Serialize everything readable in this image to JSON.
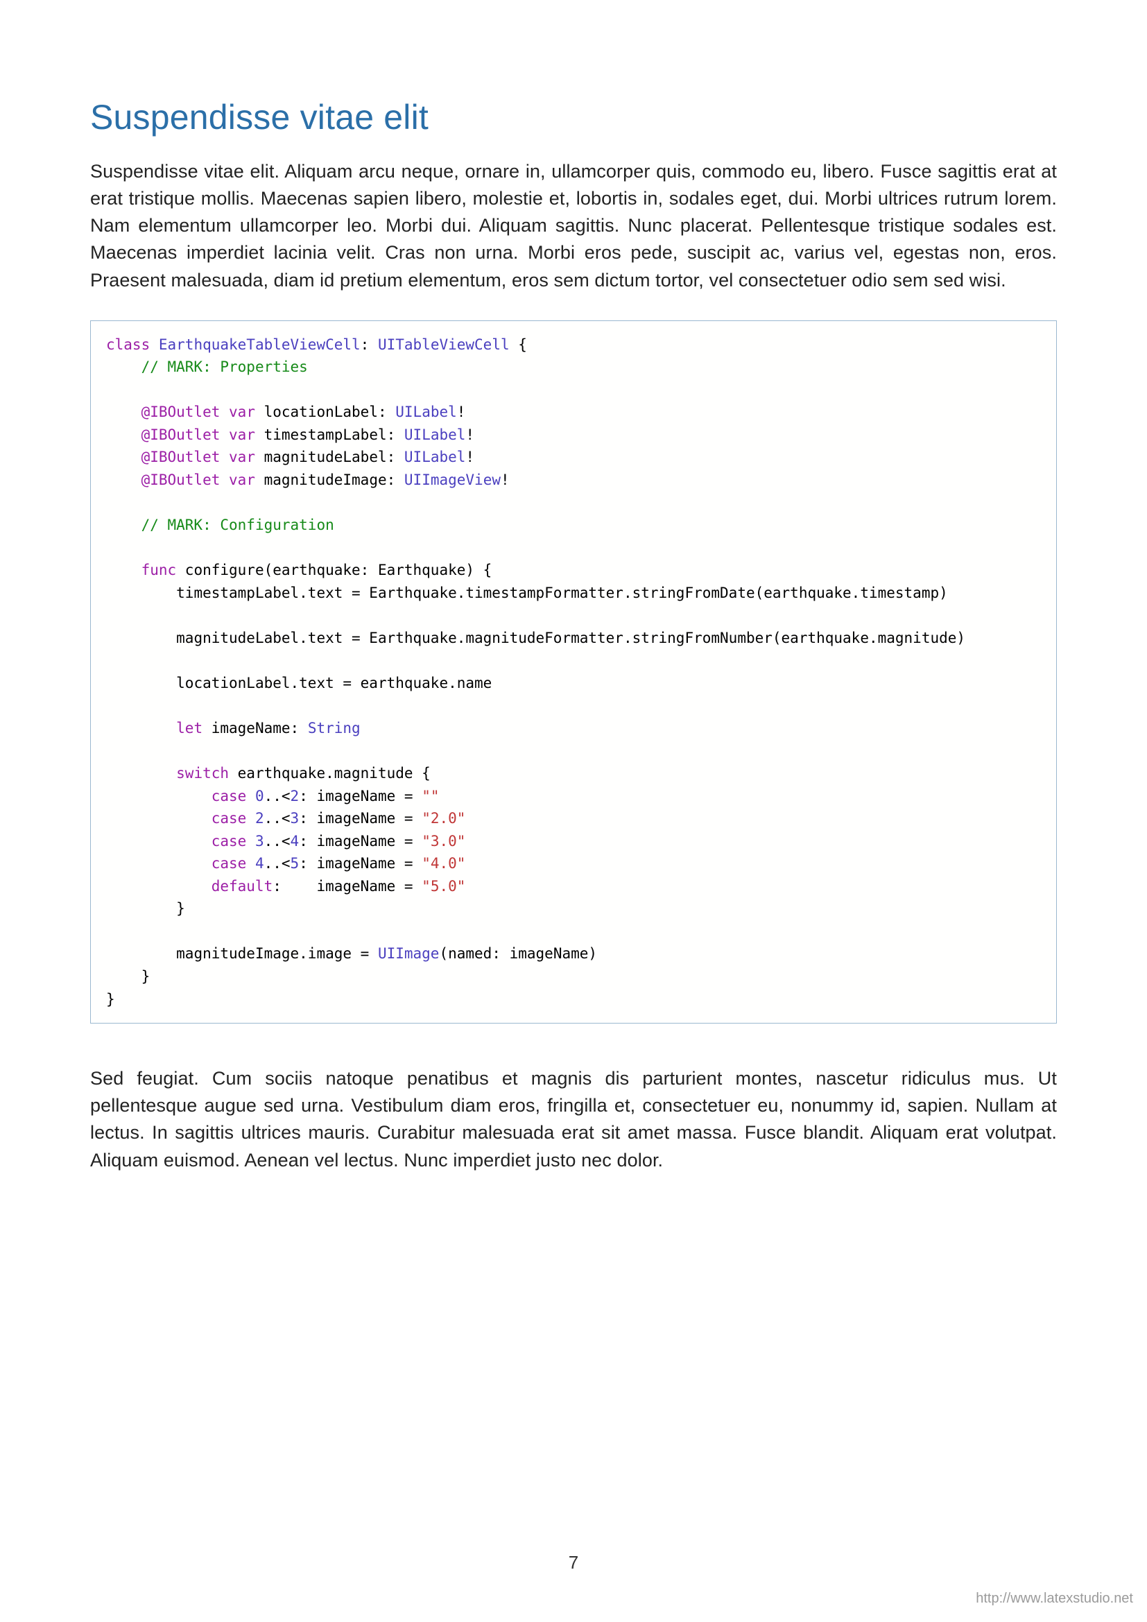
{
  "heading": "Suspendisse vitae elit",
  "paragraph1": "Suspendisse vitae elit. Aliquam arcu neque, ornare in, ullamcorper quis, commodo eu, libero. Fusce sagittis erat at erat tristique mollis. Maecenas sapien libero, molestie et, lobortis in, sodales eget, dui. Morbi ultrices rutrum lorem. Nam elementum ullamcorper leo. Morbi dui. Aliquam sagittis. Nunc placerat. Pellentesque tristique sodales est. Maecenas imperdiet lacinia velit. Cras non urna. Morbi eros pede, suscipit ac, varius vel, egestas non, eros. Praesent malesuada, diam id pretium elementum, eros sem dictum tortor, vel consectetuer odio sem sed wisi.",
  "paragraph2": "Sed feugiat. Cum sociis natoque penatibus et magnis dis parturient montes, nascetur ridiculus mus. Ut pellentesque augue sed urna. Vestibulum diam eros, fringilla et, consectetuer eu, nonummy id, sapien. Nullam at lectus. In sagittis ultrices mauris. Curabitur malesuada erat sit amet massa. Fusce blandit. Aliquam erat volutpat. Aliquam euismod. Aenean vel lectus. Nunc imperdiet justo nec dolor.",
  "code": {
    "l1_kw": "class",
    "l1_type": "EarthquakeTableViewCell",
    "l1_rest1": ": ",
    "l1_type2": "UITableViewCell",
    "l1_rest2": " {",
    "l2_cmt": "// MARK: Properties",
    "l3_attr": "@IBOutlet",
    "l3_kw": "var",
    "l3_txt": " locationLabel: ",
    "l3_type": "UILabel",
    "l3_end": "!",
    "l4_txt": " timestampLabel: ",
    "l5_txt": " magnitudeLabel: ",
    "l6_txt": " magnitudeImage: ",
    "l6_type": "UIImageView",
    "l7_cmt": "// MARK: Configuration",
    "l8_kw": "func",
    "l8_txt": " configure(earthquake: Earthquake) {",
    "l9_txt": "timestampLabel.text = Earthquake.timestampFormatter.stringFromDate(earthquake.timestamp)",
    "l10_txt": "magnitudeLabel.text = Earthquake.magnitudeFormatter.stringFromNumber(earthquake.magnitude)",
    "l11_txt": "locationLabel.text = earthquake.name",
    "l12_kw": "let",
    "l12_txt": " imageName: ",
    "l12_type": "String",
    "l13_kw": "switch",
    "l13_txt": " earthquake.magnitude {",
    "c_case": "case",
    "c_default": "default",
    "c_a": "0",
    "c_b": "2",
    "c_c": "3",
    "c_d": "4",
    "c_e": "5",
    "c_range": "..<",
    "c_mid": ": imageName = ",
    "c_s0": "\"\"",
    "c_s2": "\"2.0\"",
    "c_s3": "\"3.0\"",
    "c_s4": "\"4.0\"",
    "c_s5": "\"5.0\"",
    "c_defmid": ":    imageName = ",
    "l_close": "}",
    "l_mi_a": "magnitudeImage.image = ",
    "l_mi_type": "UIImage",
    "l_mi_b": "(named: imageName)"
  },
  "pageNumber": "7",
  "footerLink": "http://www.latexstudio.net"
}
